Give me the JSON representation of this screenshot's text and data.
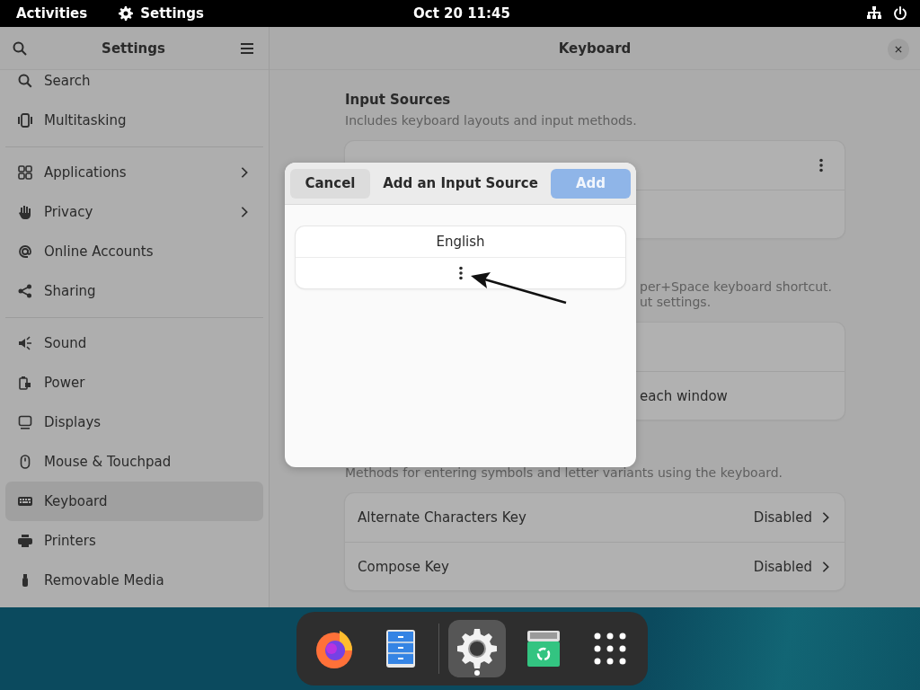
{
  "top_bar": {
    "activities": "Activities",
    "app_name": "Settings",
    "clock": "Oct 20  11:45"
  },
  "sidebar": {
    "title": "Settings",
    "groups": [
      {
        "items": [
          {
            "label": "Search",
            "submenu": false,
            "selected": false
          },
          {
            "label": "Multitasking",
            "submenu": false,
            "selected": false
          }
        ]
      },
      {
        "items": [
          {
            "label": "Applications",
            "submenu": true,
            "selected": false
          },
          {
            "label": "Privacy",
            "submenu": true,
            "selected": false
          },
          {
            "label": "Online Accounts",
            "submenu": false,
            "selected": false
          },
          {
            "label": "Sharing",
            "submenu": false,
            "selected": false
          }
        ]
      },
      {
        "items": [
          {
            "label": "Sound",
            "submenu": false,
            "selected": false
          },
          {
            "label": "Power",
            "submenu": false,
            "selected": false
          },
          {
            "label": "Displays",
            "submenu": false,
            "selected": false
          },
          {
            "label": "Mouse & Touchpad",
            "submenu": false,
            "selected": false
          },
          {
            "label": "Keyboard",
            "submenu": false,
            "selected": true
          },
          {
            "label": "Printers",
            "submenu": false,
            "selected": false
          },
          {
            "label": "Removable Media",
            "submenu": false,
            "selected": false
          }
        ]
      }
    ]
  },
  "content": {
    "title": "Keyboard",
    "input_sources": {
      "heading": "Input Sources",
      "description": "Includes keyboard layouts and input methods."
    },
    "switching": {
      "description_lines": [
        "per+Space keyboard shortcut.",
        "ut settings."
      ],
      "row_2": "each window"
    },
    "special_entry": {
      "description": "Methods for entering symbols and letter variants using the keyboard.",
      "rows": [
        {
          "label": "Alternate Characters Key",
          "value": "Disabled"
        },
        {
          "label": "Compose Key",
          "value": "Disabled"
        }
      ]
    }
  },
  "dialog": {
    "cancel": "Cancel",
    "title": "Add an Input Source",
    "add": {
      "label": "Add",
      "disabled": true
    },
    "languages": [
      "English"
    ]
  },
  "dock": {
    "apps": [
      {
        "selected": false
      },
      {
        "selected": false
      },
      {
        "selected": true
      },
      {
        "selected": false
      },
      {
        "selected": false
      }
    ]
  }
}
